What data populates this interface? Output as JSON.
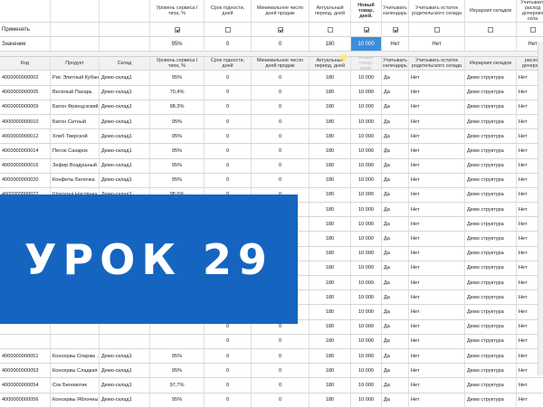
{
  "params": {
    "headers": [
      "",
      "",
      "",
      "Уровень сервиса I типа, %",
      "Срок годности, дней",
      "Минимальное число дней продаж",
      "Актуальный период, дней",
      "Новый товар, дней.",
      "Учитывать календарь",
      "Учитывать остаток родительского склада",
      "Иерархия складов",
      "Учитывать расход дочерних скла"
    ],
    "apply_label": "Применять",
    "apply_checks": [
      true,
      false,
      true,
      false,
      true,
      true,
      false,
      false,
      false,
      false
    ],
    "value_label": "Значение",
    "values": [
      "95%",
      "0",
      "0",
      "180",
      "10 000",
      "Нет",
      "Нет",
      "",
      "Нет"
    ]
  },
  "columns": [
    "Код",
    "Продукт",
    "Склад",
    "Уровень сервиса I типа, %",
    "Срок годности, дней",
    "Минимальное число дней продаж",
    "Актуальный период, дней",
    "Новый товар, дней.",
    "Учитывать календарь",
    "Учитывать остаток родительского склада",
    "Иерархия складов",
    "Учитывать расход дочерних скла"
  ],
  "rows": [
    [
      "4000000000002",
      "Рис Элитный Кубан...",
      "Демо-склад1",
      "95%",
      "0",
      "0",
      "180",
      "10 000",
      "Да",
      "Нет",
      "Демо структура",
      "Нет"
    ],
    [
      "4000000000005",
      "Весёлый Пахарь",
      "Демо-склад1",
      "70,4%",
      "0",
      "0",
      "180",
      "10 000",
      "Да",
      "Нет",
      "Демо структура",
      "Нет"
    ],
    [
      "4000000000009",
      "Батон Французский",
      "Демо-склад1",
      "98,3%",
      "0",
      "0",
      "180",
      "10 000",
      "Да",
      "Нет",
      "Демо структура",
      "Нет"
    ],
    [
      "4000000000010",
      "Батон Ситный",
      "Демо-склад1",
      "95%",
      "0",
      "0",
      "180",
      "10 000",
      "Да",
      "Нет",
      "Демо структура",
      "Нет"
    ],
    [
      "4000000000012",
      "Хлеб Тверской",
      "Демо-склад1",
      "95%",
      "0",
      "0",
      "180",
      "10 000",
      "Да",
      "Нет",
      "Демо структура",
      "Нет"
    ],
    [
      "4000000000014",
      "Песок Сахарок",
      "Демо-склад1",
      "95%",
      "0",
      "0",
      "180",
      "10 000",
      "Да",
      "Нет",
      "Демо структура",
      "Нет"
    ],
    [
      "4000000000016",
      "Зефир Воздушный",
      "Демо-склад1",
      "95%",
      "0",
      "0",
      "180",
      "10 000",
      "Да",
      "Нет",
      "Демо структура",
      "Нет"
    ],
    [
      "4000000000020",
      "Конфеты Белочка",
      "Демо-склад1",
      "95%",
      "0",
      "0",
      "180",
      "10 000",
      "Да",
      "Нет",
      "Демо структура",
      "Нет"
    ],
    [
      "4000000000022",
      "Шоколад Настёнка",
      "Демо-склад1",
      "98,6%",
      "0",
      "0",
      "180",
      "10 000",
      "Да",
      "Нет",
      "Демо структура",
      "Нет"
    ],
    [
      "4000000000023",
      "Шоколад Фёдор Д...",
      "Демо-склад1",
      "95,8%",
      "0",
      "0",
      "180",
      "10 000",
      "Да",
      "Нет",
      "Демо структура",
      "Нет"
    ],
    [
      "4000000000025",
      "",
      "",
      "",
      "0",
      "0",
      "180",
      "10 000",
      "Да",
      "Нет",
      "Демо структура",
      "Нет"
    ],
    [
      "",
      "",
      "",
      "",
      "0",
      "0",
      "180",
      "10 000",
      "Да",
      "Нет",
      "Демо структура",
      "Нет"
    ],
    [
      "",
      "",
      "",
      "",
      "0",
      "0",
      "180",
      "10 000",
      "Да",
      "Нет",
      "Демо структура",
      "Нет"
    ],
    [
      "",
      "",
      "",
      "",
      "0",
      "0",
      "180",
      "10 000",
      "Да",
      "Нет",
      "Демо структура",
      "Нет"
    ],
    [
      "",
      "",
      "",
      "",
      "0",
      "0",
      "180",
      "10 000",
      "Да",
      "Нет",
      "Демо структура",
      "Нет"
    ],
    [
      "",
      "",
      "",
      "",
      "0",
      "0",
      "180",
      "10 000",
      "Да",
      "Нет",
      "Демо структура",
      "Нет"
    ],
    [
      "",
      "",
      "",
      "",
      "0",
      "0",
      "180",
      "10 000",
      "Да",
      "Нет",
      "Демо структура",
      "Нет"
    ],
    [
      "",
      "",
      "",
      "",
      "0",
      "0",
      "180",
      "10 000",
      "Да",
      "Нет",
      "Демо структура",
      "Нет"
    ],
    [
      "",
      "",
      "",
      "",
      "0",
      "0",
      "180",
      "10 000",
      "Да",
      "Нет",
      "Демо структура",
      "Нет"
    ],
    [
      "4000000000051",
      "Консервы Спаржа ...",
      "Демо-склад1",
      "95%",
      "0",
      "0",
      "180",
      "10 000",
      "Да",
      "Нет",
      "Демо структура",
      "Нет"
    ],
    [
      "4000000000053",
      "Консервы Сладкая ...",
      "Демо-склад1",
      "95%",
      "0",
      "0",
      "180",
      "10 000",
      "Да",
      "Нет",
      "Демо структура",
      "Нет"
    ],
    [
      "4000000000054",
      "Сок Бегемотик",
      "Демо-склад1",
      "97,7%",
      "0",
      "0",
      "180",
      "10 000",
      "Да",
      "Нет",
      "Демо структура",
      "Нет"
    ],
    [
      "4000000000056",
      "Консервы Яблочны...",
      "Демо-склад1",
      "95%",
      "0",
      "0",
      "180",
      "10 000",
      "Да",
      "Нет",
      "Демо структура",
      "Нет"
    ]
  ],
  "banner": {
    "text": "УРОК 29"
  },
  "colors": {
    "highlight": "#3c8ddb",
    "banner": "#1565c0"
  }
}
